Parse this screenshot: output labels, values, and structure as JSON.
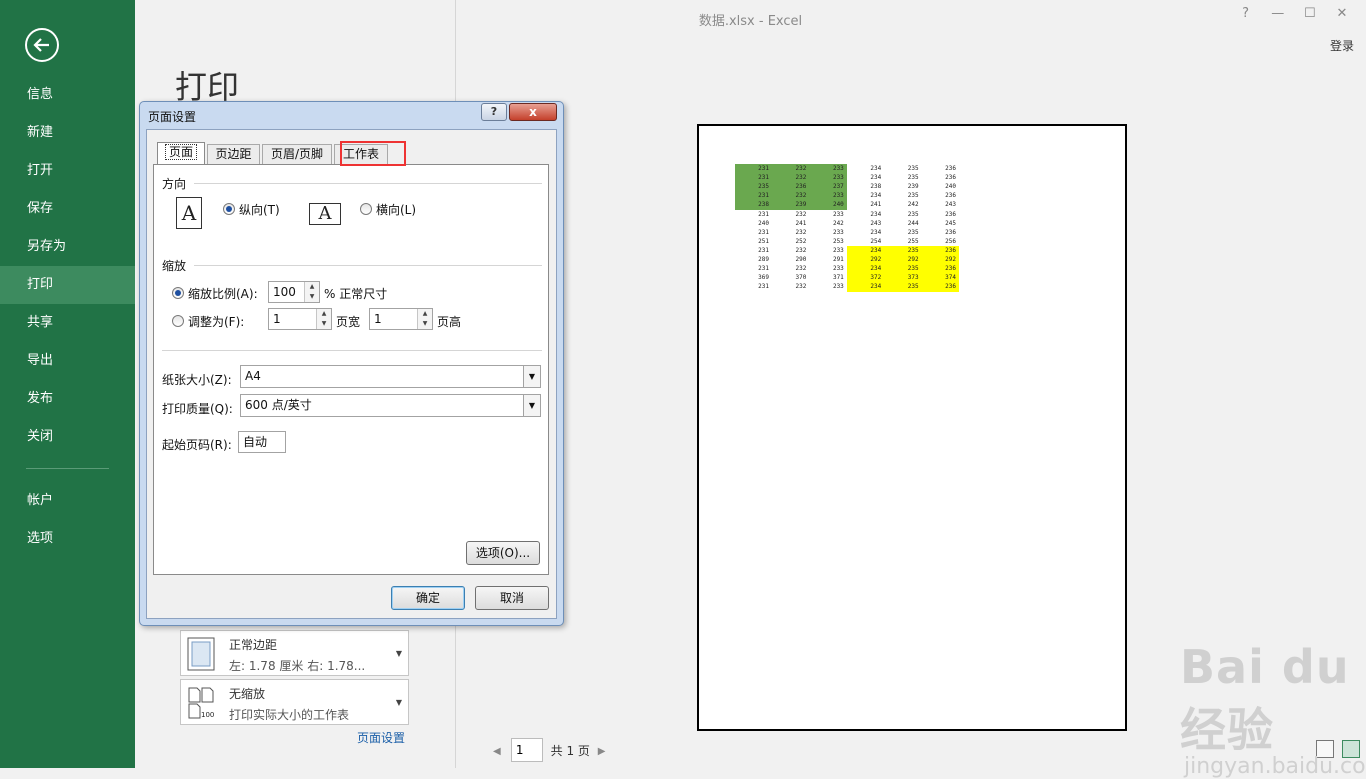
{
  "window": {
    "title": "数据.xlsx - Excel",
    "help_glyph": "?",
    "min_glyph": "—",
    "max_glyph": "☐",
    "close_glyph": "✕",
    "login": "登录"
  },
  "sidebar": {
    "items": [
      {
        "label": "信息"
      },
      {
        "label": "新建"
      },
      {
        "label": "打开"
      },
      {
        "label": "保存"
      },
      {
        "label": "另存为"
      },
      {
        "label": "打印"
      },
      {
        "label": "共享"
      },
      {
        "label": "导出"
      },
      {
        "label": "发布"
      },
      {
        "label": "关闭"
      }
    ],
    "lower_items": [
      {
        "label": "帐户"
      },
      {
        "label": "选项"
      }
    ],
    "active": "打印"
  },
  "page": {
    "heading": "打印"
  },
  "settings": {
    "margins": {
      "title": "正常边距",
      "detail": "左: 1.78 厘米    右: 1.78..."
    },
    "scaling": {
      "title": "无缩放",
      "detail": "打印实际大小的工作表",
      "icon_text": "100"
    },
    "page_setup_link": "页面设置"
  },
  "pager": {
    "current": "1",
    "total_text": "共 1 页"
  },
  "dialog": {
    "title": "页面设置",
    "help": "?",
    "close": "x",
    "tabs": [
      "页面",
      "页边距",
      "页眉/页脚",
      "工作表"
    ],
    "orientation": {
      "label": "方向",
      "portrait": "纵向(T)",
      "landscape": "横向(L)",
      "icon_letter": "A",
      "selected": "portrait"
    },
    "scaling": {
      "label": "缩放",
      "adjust_to_label": "缩放比例(A):",
      "adjust_value": "100",
      "adjust_suffix": "% 正常尺寸",
      "fit_to_label": "调整为(F):",
      "fit_wide": "1",
      "fit_wide_suffix": "页宽",
      "fit_tall": "1",
      "fit_tall_suffix": "页高"
    },
    "paper_size_label": "纸张大小(Z):",
    "paper_size_value": "A4",
    "print_quality_label": "打印质量(Q):",
    "print_quality_value": "600 点/英寸",
    "first_page_label": "起始页码(R):",
    "first_page_value": "自动",
    "options_btn": "选项(O)...",
    "ok_btn": "确定",
    "cancel_btn": "取消"
  },
  "preview_table": {
    "rows": [
      [
        "231",
        "232",
        "233",
        "234",
        "235",
        "236"
      ],
      [
        "231",
        "232",
        "233",
        "234",
        "235",
        "236"
      ],
      [
        "235",
        "236",
        "237",
        "238",
        "239",
        "240"
      ],
      [
        "231",
        "232",
        "233",
        "234",
        "235",
        "236"
      ],
      [
        "238",
        "239",
        "240",
        "241",
        "242",
        "243"
      ],
      [
        "231",
        "232",
        "233",
        "234",
        "235",
        "236"
      ],
      [
        "240",
        "241",
        "242",
        "243",
        "244",
        "245"
      ],
      [
        "231",
        "232",
        "233",
        "234",
        "235",
        "236"
      ],
      [
        "251",
        "252",
        "253",
        "254",
        "255",
        "256"
      ],
      [
        "231",
        "232",
        "233",
        "234",
        "235",
        "236"
      ],
      [
        "289",
        "290",
        "291",
        "292",
        "292",
        "292"
      ],
      [
        "231",
        "232",
        "233",
        "234",
        "235",
        "236"
      ],
      [
        "369",
        "370",
        "371",
        "372",
        "373",
        "374"
      ],
      [
        "231",
        "232",
        "233",
        "234",
        "235",
        "236"
      ]
    ],
    "highlight_colors": {
      "green": "#6aa84f",
      "yellow": "#ffff00"
    }
  },
  "watermark": {
    "line1": "Bai du 经验",
    "line2": "jingyan.baidu.com"
  },
  "colors": {
    "sidebar": "#217346",
    "sidebar_active": "#3d8b5f",
    "tab_highlight": "#ee3333"
  }
}
